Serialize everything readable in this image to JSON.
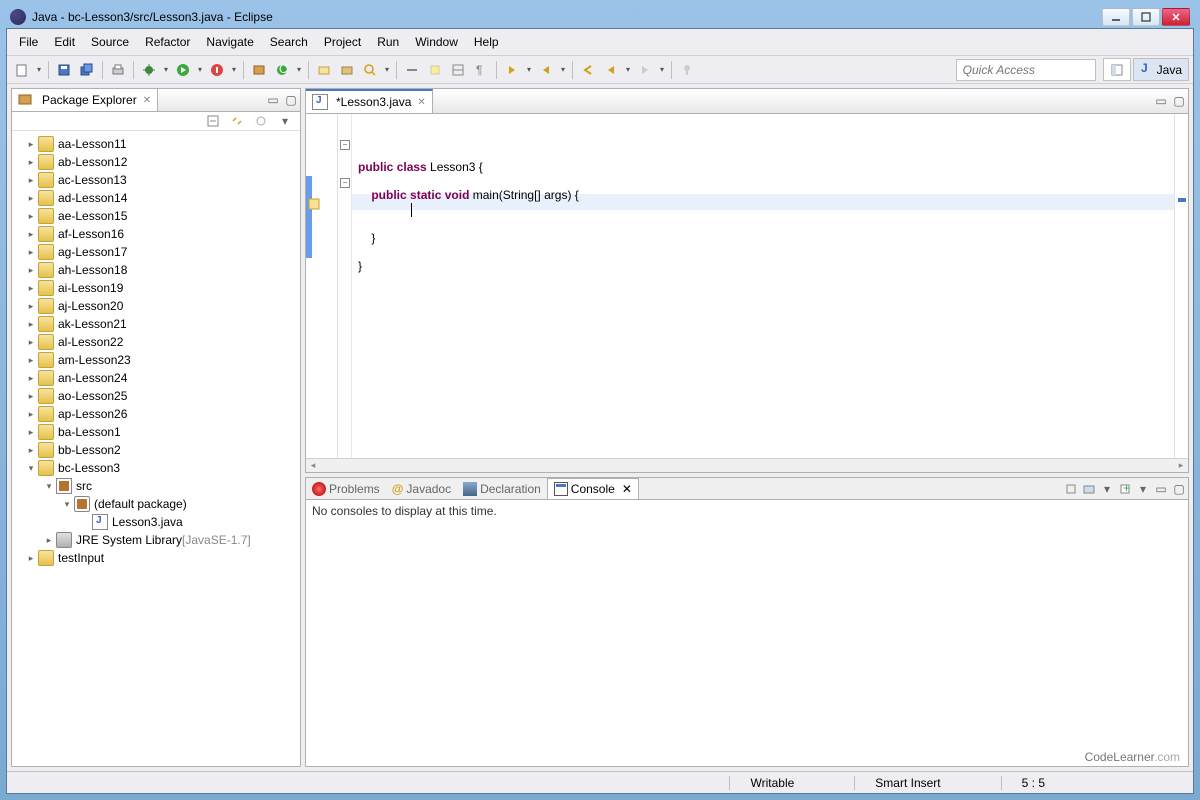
{
  "window": {
    "title": "Java - bc-Lesson3/src/Lesson3.java - Eclipse"
  },
  "menu": [
    "File",
    "Edit",
    "Source",
    "Refactor",
    "Navigate",
    "Search",
    "Project",
    "Run",
    "Window",
    "Help"
  ],
  "quick_access": {
    "placeholder": "Quick Access"
  },
  "perspective": {
    "java": "Java"
  },
  "package_explorer": {
    "title": "Package Explorer",
    "projects": [
      {
        "name": "aa-Lesson11",
        "level": 1,
        "tw": "closed",
        "ic": "folder"
      },
      {
        "name": "ab-Lesson12",
        "level": 1,
        "tw": "closed",
        "ic": "folder"
      },
      {
        "name": "ac-Lesson13",
        "level": 1,
        "tw": "closed",
        "ic": "folder"
      },
      {
        "name": "ad-Lesson14",
        "level": 1,
        "tw": "closed",
        "ic": "folder"
      },
      {
        "name": "ae-Lesson15",
        "level": 1,
        "tw": "closed",
        "ic": "folder"
      },
      {
        "name": "af-Lesson16",
        "level": 1,
        "tw": "closed",
        "ic": "folder"
      },
      {
        "name": "ag-Lesson17",
        "level": 1,
        "tw": "closed",
        "ic": "folder"
      },
      {
        "name": "ah-Lesson18",
        "level": 1,
        "tw": "closed",
        "ic": "folder"
      },
      {
        "name": "ai-Lesson19",
        "level": 1,
        "tw": "closed",
        "ic": "folder"
      },
      {
        "name": "aj-Lesson20",
        "level": 1,
        "tw": "closed",
        "ic": "folder"
      },
      {
        "name": "ak-Lesson21",
        "level": 1,
        "tw": "closed",
        "ic": "folder"
      },
      {
        "name": "al-Lesson22",
        "level": 1,
        "tw": "closed",
        "ic": "folder"
      },
      {
        "name": "am-Lesson23",
        "level": 1,
        "tw": "closed",
        "ic": "folder"
      },
      {
        "name": "an-Lesson24",
        "level": 1,
        "tw": "closed",
        "ic": "folder"
      },
      {
        "name": "ao-Lesson25",
        "level": 1,
        "tw": "closed",
        "ic": "folder"
      },
      {
        "name": "ap-Lesson26",
        "level": 1,
        "tw": "closed",
        "ic": "folder"
      },
      {
        "name": "ba-Lesson1",
        "level": 1,
        "tw": "closed",
        "ic": "folder"
      },
      {
        "name": "bb-Lesson2",
        "level": 1,
        "tw": "closed",
        "ic": "folder"
      },
      {
        "name": "bc-Lesson3",
        "level": 1,
        "tw": "open",
        "ic": "folder"
      },
      {
        "name": "src",
        "level": 2,
        "tw": "open",
        "ic": "src"
      },
      {
        "name": "(default package)",
        "level": 3,
        "tw": "open",
        "ic": "pkg"
      },
      {
        "name": "Lesson3.java",
        "level": 4,
        "tw": "none",
        "ic": "java"
      },
      {
        "name": "JRE System Library",
        "suffix": "[JavaSE-1.7]",
        "level": 2,
        "tw": "closed",
        "ic": "lib"
      },
      {
        "name": "testInput",
        "level": 1,
        "tw": "closed",
        "ic": "folder"
      }
    ]
  },
  "editor": {
    "tab": "*Lesson3.java",
    "code": {
      "l1_kw1": "public",
      "l1_kw2": "class",
      "l1_rest": " Lesson3 {",
      "l2_kw1": "public",
      "l2_kw2": "static",
      "l2_kw3": "void",
      "l2_rest": " main(String[] args) {",
      "l3_close": "}",
      "l4_close": "}"
    }
  },
  "bottom": {
    "tabs": {
      "problems": "Problems",
      "javadoc": "Javadoc",
      "declaration": "Declaration",
      "console": "Console"
    },
    "console_msg": "No consoles to display at this time."
  },
  "status": {
    "writable": "Writable",
    "insert": "Smart Insert",
    "pos": "5 : 5"
  },
  "watermark": {
    "brand": "CodeLearner",
    "dot": ".",
    "tld": "com"
  }
}
